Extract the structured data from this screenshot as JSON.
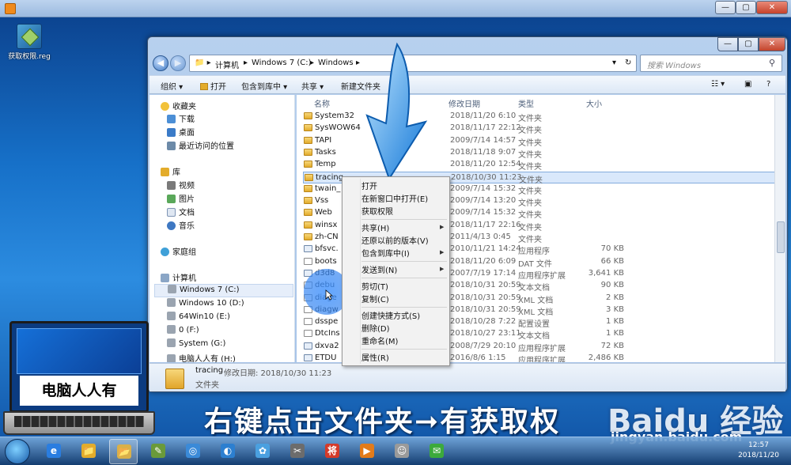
{
  "outer_window": {
    "controls": [
      "—",
      "▢",
      "✕"
    ]
  },
  "desktop": {
    "icon_label": "获取权限.reg"
  },
  "explorer": {
    "controls": [
      "—",
      "▢",
      "✕"
    ],
    "breadcrumb": [
      "计算机",
      "Windows 7 (C:)",
      "Windows"
    ],
    "search_placeholder": "搜索 Windows",
    "toolbar": [
      "组织 ▾",
      "打开",
      "包含到库中 ▾",
      "共享 ▾",
      "新建文件夹"
    ],
    "nav": {
      "favorites": "收藏夹",
      "fav_items": [
        "下载",
        "桌面",
        "最近访问的位置"
      ],
      "libraries": "库",
      "lib_items": [
        "视频",
        "图片",
        "文档",
        "音乐"
      ],
      "homegroup": "家庭组",
      "computer": "计算机",
      "drives": [
        "Windows 7 (C:)",
        "Windows 10 (D:)",
        "64Win10 (E:)",
        "0 (F:)",
        "System (G:)",
        "电脑人人有 (H:)"
      ]
    },
    "columns": {
      "name": "名称",
      "date": "修改日期",
      "type": "类型",
      "size": "大小"
    },
    "files": [
      {
        "name": "System32",
        "date": "2018/11/20 6:10",
        "type": "文件夹",
        "size": "",
        "kind": "folder"
      },
      {
        "name": "SysWOW64",
        "date": "2018/11/17 22:12",
        "type": "文件夹",
        "size": "",
        "kind": "folder"
      },
      {
        "name": "TAPI",
        "date": "2009/7/14 14:57",
        "type": "文件夹",
        "size": "",
        "kind": "folder"
      },
      {
        "name": "Tasks",
        "date": "2018/11/18 9:07",
        "type": "文件夹",
        "size": "",
        "kind": "folder"
      },
      {
        "name": "Temp",
        "date": "2018/11/20 12:54",
        "type": "文件夹",
        "size": "",
        "kind": "folder"
      },
      {
        "name": "tracing",
        "date": "2018/10/30 11:23",
        "type": "文件夹",
        "size": "",
        "kind": "folder",
        "selected": true
      },
      {
        "name": "twain_",
        "date": "2009/7/14 15:32",
        "type": "文件夹",
        "size": "",
        "kind": "folder"
      },
      {
        "name": "Vss",
        "date": "2009/7/14 13:20",
        "type": "文件夹",
        "size": "",
        "kind": "folder"
      },
      {
        "name": "Web",
        "date": "2009/7/14 15:32",
        "type": "文件夹",
        "size": "",
        "kind": "folder"
      },
      {
        "name": "winsx",
        "date": "2018/11/17 22:16",
        "type": "文件夹",
        "size": "",
        "kind": "folder"
      },
      {
        "name": "zh-CN",
        "date": "2011/4/13 0:45",
        "type": "文件夹",
        "size": "",
        "kind": "folder"
      },
      {
        "name": "bfsvc.",
        "date": "2010/11/21 14:24",
        "type": "应用程序",
        "size": "70 KB",
        "kind": "sys"
      },
      {
        "name": "boots",
        "date": "2018/11/20 6:09",
        "type": "DAT 文件",
        "size": "66 KB",
        "kind": "file"
      },
      {
        "name": "d3d8",
        "date": "2007/7/19 17:14",
        "type": "应用程序扩展",
        "size": "3,641 KB",
        "kind": "sys"
      },
      {
        "name": "debu",
        "date": "2018/10/31 20:59",
        "type": "文本文档",
        "size": "90 KB",
        "kind": "file"
      },
      {
        "name": "diage",
        "date": "2018/10/31 20:59",
        "type": "XML 文档",
        "size": "2 KB",
        "kind": "file"
      },
      {
        "name": "diagw",
        "date": "2018/10/31 20:59",
        "type": "XML 文档",
        "size": "3 KB",
        "kind": "file"
      },
      {
        "name": "dsspe",
        "date": "2018/10/28 7:22",
        "type": "配置设置",
        "size": "1 KB",
        "kind": "file"
      },
      {
        "name": "DtcIns",
        "date": "2018/10/27 23:11",
        "type": "文本文档",
        "size": "1 KB",
        "kind": "file"
      },
      {
        "name": "dxva2",
        "date": "2008/7/29 20:10",
        "type": "应用程序扩展",
        "size": "72 KB",
        "kind": "sys"
      },
      {
        "name": "ETDU",
        "date": "2016/8/6 1:15",
        "type": "应用程序扩展",
        "size": "2,486 KB",
        "kind": "sys"
      }
    ],
    "details": {
      "name": "tracing",
      "meta": "修改日期: 2018/10/30 11:23",
      "type": "文件夹"
    }
  },
  "context_menu": {
    "items": [
      {
        "label": "打开",
        "sub": false
      },
      {
        "label": "在新窗口中打开(E)",
        "sub": false
      },
      {
        "label": "获取权限",
        "sub": false
      },
      {
        "label": "---"
      },
      {
        "label": "共享(H)",
        "sub": true
      },
      {
        "label": "还原以前的版本(V)",
        "sub": false
      },
      {
        "label": "包含到库中(I)",
        "sub": true
      },
      {
        "label": "---"
      },
      {
        "label": "发送到(N)",
        "sub": true
      },
      {
        "label": "---"
      },
      {
        "label": "剪切(T)",
        "sub": false
      },
      {
        "label": "复制(C)",
        "sub": false
      },
      {
        "label": "---"
      },
      {
        "label": "创建快捷方式(S)",
        "sub": false
      },
      {
        "label": "删除(D)",
        "sub": false
      },
      {
        "label": "重命名(M)",
        "sub": false
      },
      {
        "label": "---"
      },
      {
        "label": "属性(R)",
        "sub": false
      }
    ]
  },
  "caption": "右键点击文件夹➞有获取权",
  "watermark": {
    "brand": "Baidu 经验",
    "site": "jingyan.baidu.com"
  },
  "logo_text": "电脑人人有",
  "taskbar": {
    "apps": [
      "e",
      "📁",
      "📂",
      "✎",
      "◎",
      "◐",
      "✿",
      "✂",
      "将",
      "▶",
      "☺",
      "✉"
    ],
    "time": "12:57",
    "date": "2018/11/20"
  },
  "colors": {
    "accent": "#1e76d4",
    "selection": "#d9e8fb",
    "folder": "#e3ac2b"
  }
}
